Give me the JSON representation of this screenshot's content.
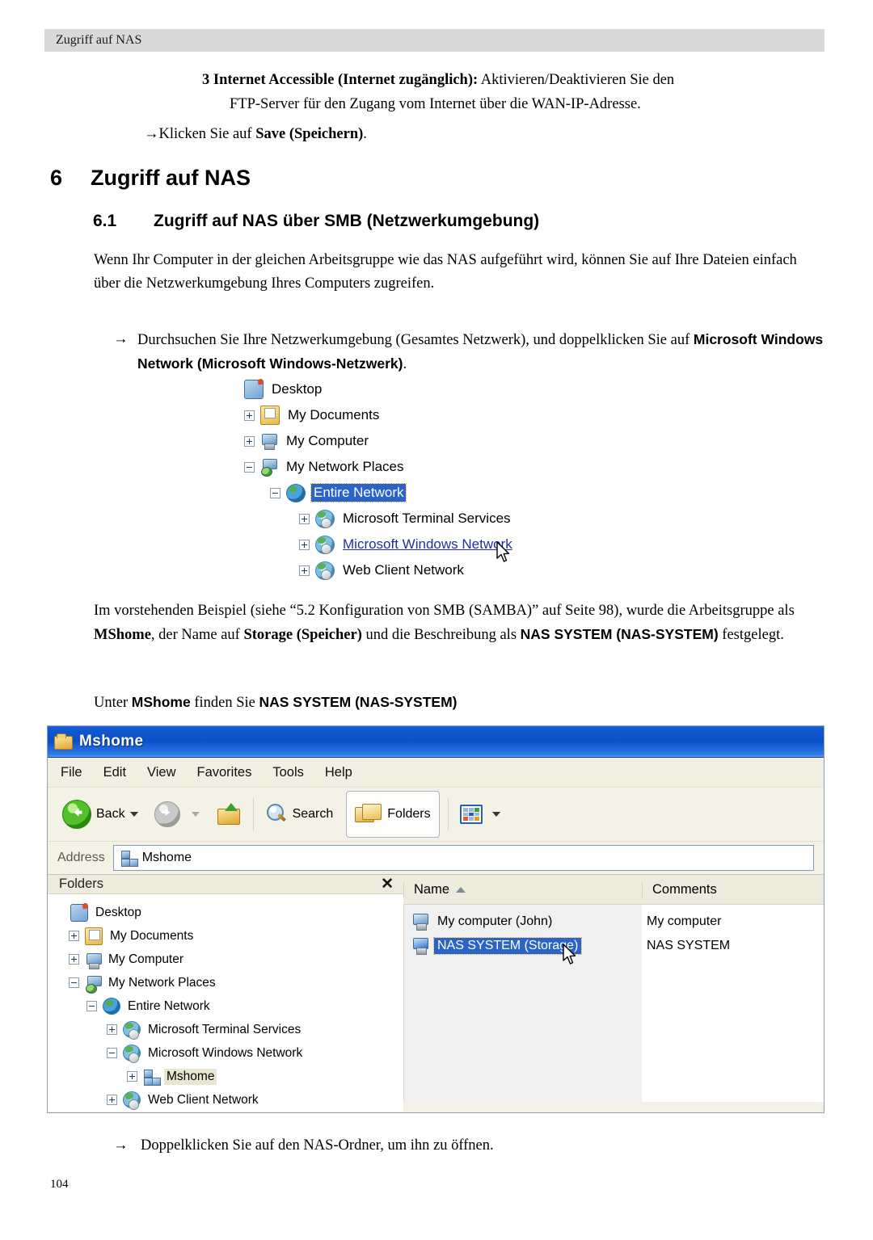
{
  "page": {
    "running_header": "Zugriff auf NAS",
    "page_number": "104"
  },
  "step3": {
    "number": "3",
    "bold_lead": "Internet Accessible (Internet zugänglich):",
    "rest": " Aktivieren/Deaktivieren Sie den",
    "line2": "FTP-Server für den Zugang vom Internet über die WAN-IP-Adresse."
  },
  "click_save": {
    "arrow": "→",
    "text": "Klicken Sie auf ",
    "bold": "Save (Speichern)",
    "tail": "."
  },
  "heading1": {
    "number": "6",
    "text": "Zugriff auf NAS"
  },
  "heading2": {
    "number": "6.1",
    "text": "Zugriff auf NAS über SMB (Netzwerkumgebung)"
  },
  "para1": "Wenn Ihr Computer in der gleichen Arbeitsgruppe wie das NAS aufgeführt wird, können Sie auf Ihre Dateien einfach über die Netzwerkumgebung Ihres Computers zugreifen.",
  "bullet1": {
    "arrow": "→",
    "text": "Durchsuchen Sie Ihre Netzwerkumgebung (Gesamtes Netzwerk), und doppelklicken Sie auf ",
    "bold": "Microsoft Windows Network (Microsoft Windows-Netzwerk)",
    "tail": "."
  },
  "para2": {
    "p1": "Im vorstehenden Beispiel (siehe “5.2 Konfiguration von SMB (SAMBA)”  auf Seite  98), wurde die Arbeitsgruppe als ",
    "b1": "MShome",
    "p2": ", der Name auf ",
    "b2": "Storage (Speicher)",
    "p3": " und die Beschreibung als ",
    "b3": "NAS SYSTEM (NAS-SYSTEM)",
    "p4": " festgelegt."
  },
  "para3": {
    "p1": "Unter ",
    "b1": "MShome",
    "p2": " finden Sie ",
    "b2": "NAS SYSTEM (NAS-SYSTEM)"
  },
  "bullet2": {
    "arrow": "→",
    "text": "Doppelklicken Sie auf den NAS-Ordner, um ihn zu öffnen."
  },
  "figure_tree1": {
    "items": [
      {
        "label": "Desktop",
        "toggle": "none",
        "icon": "desktop-icon",
        "state": "normal",
        "indent": 0
      },
      {
        "label": "My Documents",
        "toggle": "plus",
        "icon": "my-documents-icon",
        "state": "normal",
        "indent": 1
      },
      {
        "label": "My Computer",
        "toggle": "plus",
        "icon": "my-computer-icon",
        "state": "normal",
        "indent": 1
      },
      {
        "label": "My Network Places",
        "toggle": "minus",
        "icon": "network-places-icon",
        "state": "normal",
        "indent": 1
      },
      {
        "label": "Entire Network",
        "toggle": "minus",
        "icon": "globe-icon",
        "state": "selected",
        "indent": 2
      },
      {
        "label": "Microsoft Terminal Services",
        "toggle": "plus",
        "icon": "globe-computer-icon",
        "state": "normal",
        "indent": 3
      },
      {
        "label": "Microsoft Windows Network",
        "toggle": "plus",
        "icon": "globe-computer-icon",
        "state": "link",
        "indent": 3
      },
      {
        "label": "Web Client Network",
        "toggle": "plus",
        "icon": "globe-computer-icon",
        "state": "normal",
        "indent": 3
      }
    ]
  },
  "explorer": {
    "title": "Mshome",
    "menu": [
      "File",
      "Edit",
      "View",
      "Favorites",
      "Tools",
      "Help"
    ],
    "toolbar": {
      "back": "Back",
      "search": "Search",
      "folders": "Folders"
    },
    "address": {
      "label": "Address",
      "value": "Mshome"
    },
    "folders_pane": {
      "title": "Folders",
      "close": "✕",
      "tree": [
        {
          "label": "Desktop",
          "toggle": "none",
          "icon": "desktop-icon",
          "state": "normal",
          "indent": 0
        },
        {
          "label": "My Documents",
          "toggle": "plus",
          "icon": "my-documents-icon",
          "state": "normal",
          "indent": 1
        },
        {
          "label": "My Computer",
          "toggle": "plus",
          "icon": "my-computer-icon",
          "state": "normal",
          "indent": 1
        },
        {
          "label": "My Network Places",
          "toggle": "minus",
          "icon": "network-places-icon",
          "state": "normal",
          "indent": 1
        },
        {
          "label": "Entire Network",
          "toggle": "minus",
          "icon": "globe-icon",
          "state": "normal",
          "indent": 2
        },
        {
          "label": "Microsoft Terminal Services",
          "toggle": "plus",
          "icon": "globe-computer-icon",
          "state": "normal",
          "indent": 3
        },
        {
          "label": "Microsoft Windows Network",
          "toggle": "minus",
          "icon": "globe-computer-icon",
          "state": "normal",
          "indent": 3
        },
        {
          "label": "Mshome",
          "toggle": "plus",
          "icon": "workgroup-icon",
          "state": "highlight",
          "indent": 4
        },
        {
          "label": "Web Client Network",
          "toggle": "plus",
          "icon": "globe-computer-icon",
          "state": "normal",
          "indent": 3
        }
      ]
    },
    "list_pane": {
      "columns": [
        "Name",
        "Comments"
      ],
      "sort": "ascending",
      "rows": [
        {
          "name": "My computer (John)",
          "comments": "My computer",
          "selected": false
        },
        {
          "name": "NAS SYSTEM (Storage)",
          "comments": "NAS SYSTEM",
          "selected": true
        }
      ]
    }
  },
  "colors": {
    "titlebar_blue": "#0a50c6",
    "selection_blue": "#2a64c8",
    "header_band": "#d9d9d9",
    "chrome_beige": "#f4f2e6"
  }
}
